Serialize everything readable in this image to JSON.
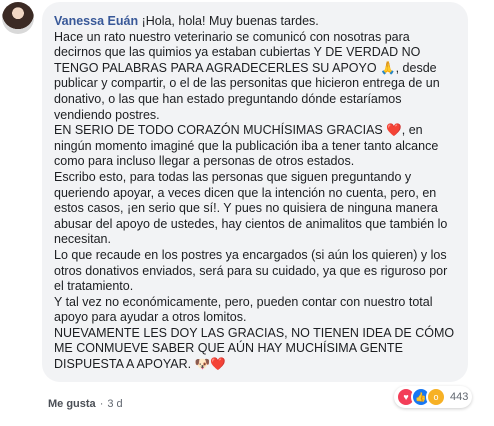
{
  "comment": {
    "author": "Vanessa Euán",
    "paragraphs": [
      "¡Hola, hola! Muy buenas tardes.",
      "Hace un rato nuestro veterinario se comunicó con nosotras para decirnos que las quimios ya estaban cubiertas Y DE VERDAD NO TENGO PALABRAS PARA AGRADECERLES SU APOYO 🙏, desde publicar y compartir, o el de las personitas que hicieron entrega de un donativo, o las que han estado preguntando dónde estaríamos vendiendo postres.",
      "EN SERIO DE TODO CORAZÓN MUCHÍSIMAS GRACIAS ❤️, en ningún momento imaginé que la publicación iba a tener tanto alcance como para incluso llegar a personas de otros estados.",
      "Escribo esto, para todas las personas que siguen preguntando y queriendo apoyar, a veces dicen que la intención no cuenta, pero, en estos casos, ¡en serio que sí!. Y pues no quisiera de ninguna manera abusar del apoyo de ustedes, hay cientos de animalitos que también lo necesitan.",
      "Lo que recaude en los postres ya encargados (si aún los quieren) y los otros donativos enviados, será para su cuidado, ya que es riguroso por el tratamiento.",
      "Y tal vez no económicamente, pero, pueden contar con nuestro total apoyo para ayudar a otros lomitos.",
      "NUEVAMENTE LES DOY LAS GRACIAS, NO TIENEN IDEA DE CÓMO ME CONMUEVE SABER QUE AÚN HAY MUCHÍSIMA GENTE DISPUESTA A APOYAR. 🐶❤️"
    ]
  },
  "footer": {
    "like_label": "Me gusta",
    "separator": "·",
    "time": "3 d"
  },
  "reactions": {
    "count": "443",
    "types": [
      "love-icon",
      "like-icon",
      "wow-icon"
    ],
    "colors": {
      "love": "#f33e58",
      "like": "#1877f2",
      "wow": "#f7b125"
    }
  },
  "colors": {
    "author": "#385898",
    "bubble": "#f2f3f5",
    "meta": "#616770"
  }
}
